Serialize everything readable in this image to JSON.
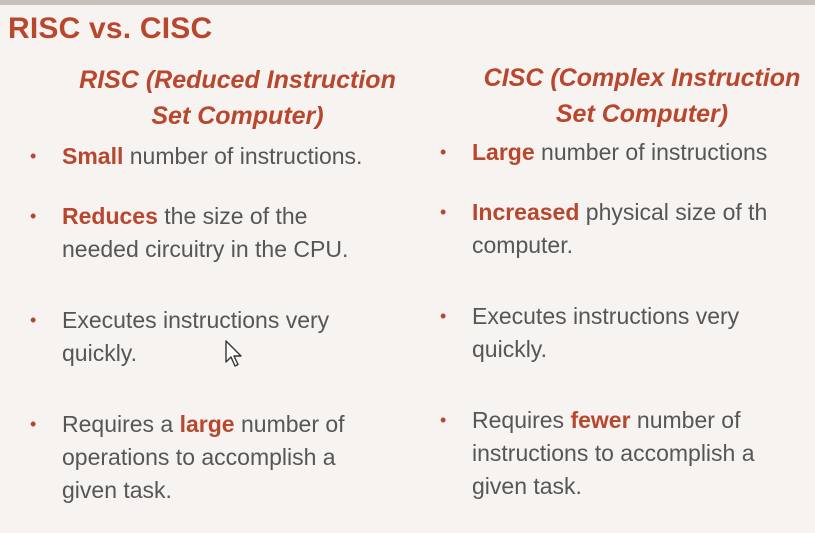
{
  "title": "RISC vs. CISC",
  "risc": {
    "heading_line1": "RISC (Reduced Instruction",
    "heading_line2": "Set Computer)",
    "items": [
      {
        "bold": "Small",
        "rest": " number of instructions.",
        "line2": ""
      },
      {
        "bold": "Reduces",
        "rest": " the size of the",
        "line2": "needed circuitry in the CPU."
      },
      {
        "pre": "Executes instructions very",
        "line2": "quickly."
      },
      {
        "pre": "Requires a ",
        "bold": "large",
        "rest": " number of",
        "line2": "operations to accomplish a",
        "line3": "given task."
      }
    ]
  },
  "cisc": {
    "heading_line1": "CISC (Complex Instruction",
    "heading_line2": "Set Computer)",
    "items": [
      {
        "bold": "Large",
        "rest": " number of instructions"
      },
      {
        "bold": "Increased",
        "rest": " physical size of th",
        "line2": "computer."
      },
      {
        "pre": "Executes instructions very",
        "line2": "quickly."
      },
      {
        "pre": "Requires ",
        "bold": "fewer",
        "rest": " number of",
        "line2": "instructions to accomplish a",
        "line3": "given task."
      }
    ]
  },
  "colors": {
    "accent": "#b9472e",
    "body_text": "#565656",
    "background": "#f6f3f0"
  },
  "icons": {
    "bullet": "bullet-dot-icon",
    "cursor": "mouse-pointer-icon"
  }
}
